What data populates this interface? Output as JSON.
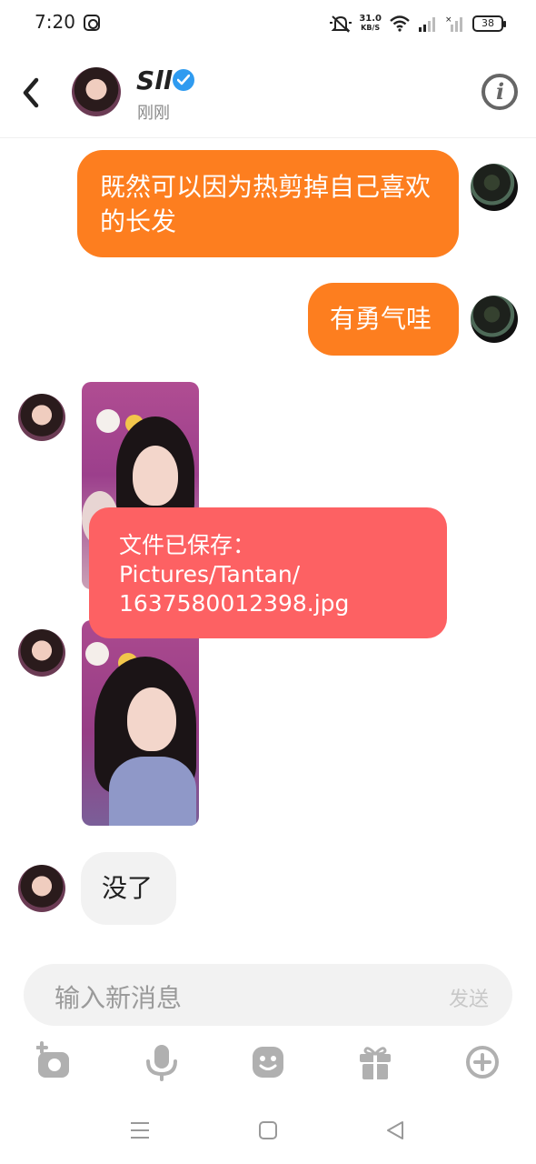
{
  "status_bar": {
    "time": "7:20",
    "speed_value": "31.0",
    "speed_unit": "KB/S",
    "battery": "38"
  },
  "header": {
    "contact_name": "Sll",
    "last_seen": "刚刚"
  },
  "messages": [
    {
      "direction": "out",
      "type": "text",
      "text": "既然可以因为热剪掉自己喜欢的长发"
    },
    {
      "direction": "out",
      "type": "text",
      "text": "有勇气哇"
    },
    {
      "direction": "in",
      "type": "photo"
    },
    {
      "direction": "in",
      "type": "photo"
    },
    {
      "direction": "in",
      "type": "text",
      "text": "没了"
    }
  ],
  "toast": {
    "line1": "文件已保存：",
    "line2": "Pictures/Tantan/",
    "line3": "1637580012398.jpg"
  },
  "composer": {
    "placeholder": "输入新消息",
    "send_label": "发送"
  },
  "toolbar_icons": [
    "camera-icon",
    "microphone-icon",
    "emoji-icon",
    "gift-icon",
    "plus-icon"
  ],
  "colors": {
    "outgoing_bubble": "#fd7e1f",
    "incoming_bubble": "#f2f2f2",
    "toast": "#fd6163",
    "verified": "#2f9bf0"
  }
}
